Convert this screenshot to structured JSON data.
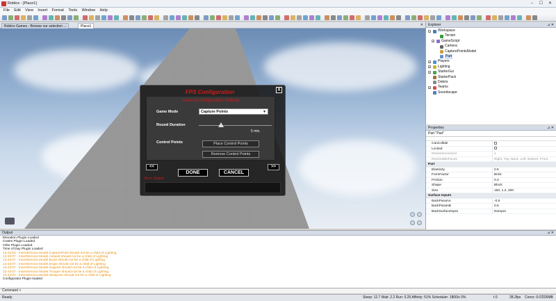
{
  "window": {
    "title": "Roblox - [Place1]",
    "minimize": "–",
    "maximize": "☐",
    "close": "✕"
  },
  "menu": [
    "File",
    "Edit",
    "View",
    "Insert",
    "Format",
    "Tools",
    "Window",
    "Help"
  ],
  "tabs": [
    {
      "label": "Roblox Games - Browse our selection ..."
    },
    {
      "label": "Place1"
    }
  ],
  "dialog": {
    "title": "FPS Configuration",
    "subtitle": "General Configuration Settings",
    "close": "X",
    "game_mode_label": "Game Mode",
    "game_mode_value": "Capture Points",
    "round_duration_label": "Round Duration",
    "round_duration_value": "5 min.",
    "round_duration_fraction": 0.3,
    "control_points_label": "Control Points",
    "place_button": "Place Control Points",
    "remove_button": "Remove Control Points",
    "prev": "<<",
    "next": ">>",
    "done": "DONE",
    "cancel": "CANCEL",
    "error_label": "Error Output"
  },
  "explorer": {
    "title": "Explorer",
    "items": [
      {
        "label": "Workspace",
        "level": 0,
        "exp": "−",
        "color": "#3f7fbf"
      },
      {
        "label": "Terrain",
        "level": 2,
        "exp": "",
        "color": "#3a9a3a"
      },
      {
        "label": "GameScript",
        "level": 1,
        "exp": "+",
        "color": "#8a6ad0"
      },
      {
        "label": "Camera",
        "level": 2,
        "exp": "",
        "color": "#666666"
      },
      {
        "label": "CapturePointsModel",
        "level": 2,
        "exp": "",
        "color": "#c8a040"
      },
      {
        "label": "Part",
        "level": 2,
        "exp": "",
        "color": "#6a8fd0",
        "selected": true
      },
      {
        "label": "Players",
        "level": 0,
        "exp": "+",
        "color": "#4a90d0"
      },
      {
        "label": "Lighting",
        "level": 0,
        "exp": "+",
        "color": "#d0b030"
      },
      {
        "label": "StarterGui",
        "level": 0,
        "exp": "+",
        "color": "#50a050"
      },
      {
        "label": "StarterPack",
        "level": 0,
        "exp": "",
        "color": "#a07040"
      },
      {
        "label": "Debris",
        "level": 0,
        "exp": "",
        "color": "#888888"
      },
      {
        "label": "Teams",
        "level": 0,
        "exp": "+",
        "color": "#d05050"
      },
      {
        "label": "Soundscape",
        "level": 0,
        "exp": "",
        "color": "#5080c0"
      }
    ]
  },
  "properties": {
    "title": "Properties",
    "subtitle": "Part \"Part\"",
    "rows": [
      {
        "k": "CanCollide",
        "v": "",
        "check": true
      },
      {
        "k": "Locked",
        "v": "",
        "check": true
      },
      {
        "k": "ResizeIncrement",
        "v": "1",
        "dim": true
      },
      {
        "k": "ResizeableFaces",
        "v": "Right, Top, Back, Left, Bottom, Front",
        "dim": true
      },
      {
        "k": "Part",
        "v": "",
        "cat": true
      },
      {
        "k": "Elasticity",
        "v": "0.5"
      },
      {
        "k": "FormFactor",
        "v": "Brick"
      },
      {
        "k": "Friction",
        "v": "0.3"
      },
      {
        "k": "Shape",
        "v": "Block"
      },
      {
        "k": "Size",
        "v": "150, 1.2, 200"
      },
      {
        "k": "Surface Inputs",
        "v": "",
        "cat": true
      },
      {
        "k": "BackParamA",
        "v": "-0.5"
      },
      {
        "k": "BackParamB",
        "v": "0.5"
      },
      {
        "k": "BackSurfaceInput",
        "v": "NoInput"
      }
    ]
  },
  "output": {
    "title": "Output",
    "lines": [
      {
        "t": "Elevation Plugin Loaded",
        "warn": false
      },
      {
        "t": "Crates Plugin Loaded",
        "warn": false
      },
      {
        "t": "Orbs Plugin Loaded",
        "warn": false
      },
      {
        "t": "Time of Day Plugin Loaded",
        "warn": false
      },
      {
        "t": "13:43:03 - InsertService.Model.CapturePoint should not be a child of Lighting",
        "warn": true
      },
      {
        "t": "13:43:07 - InsertService.Model.Assault should not be a child of Lighting",
        "warn": true
      },
      {
        "t": "13:43:07 - InsertService.Model.Brute should not be a child of Lighting",
        "warn": true
      },
      {
        "t": "13:43:07 - InsertService.Model.Engie should not be a child of Lighting",
        "warn": true
      },
      {
        "t": "13:43:07 - InsertService.Model.Support should not be a child of Lighting",
        "warn": true
      },
      {
        "t": "13:43:07 - InsertService.Model.Trooper should not be a child of Lighting",
        "warn": true
      },
      {
        "t": "13:43:07 - InsertService.Model.Weapons should not be a child of Lighting",
        "warn": true
      },
      {
        "t": "Configurator Plugin loaded",
        "warn": false
      }
    ]
  },
  "command": {
    "label": "Command >"
  },
  "status": {
    "left": "Ready",
    "stats": "Sleep: 12.7 Wait: 2.2 Run: 0.25 Affinity: 51% Scheduler: 1800/s 0%",
    "t": "t 0",
    "fps": "28.2fps",
    "cores": "Cores: 0.07",
    "mem": "226MB"
  },
  "colors": {
    "accent_red": "#d21a1a",
    "warning_orange": "#e8900c",
    "dialog_bg": "#121212"
  }
}
